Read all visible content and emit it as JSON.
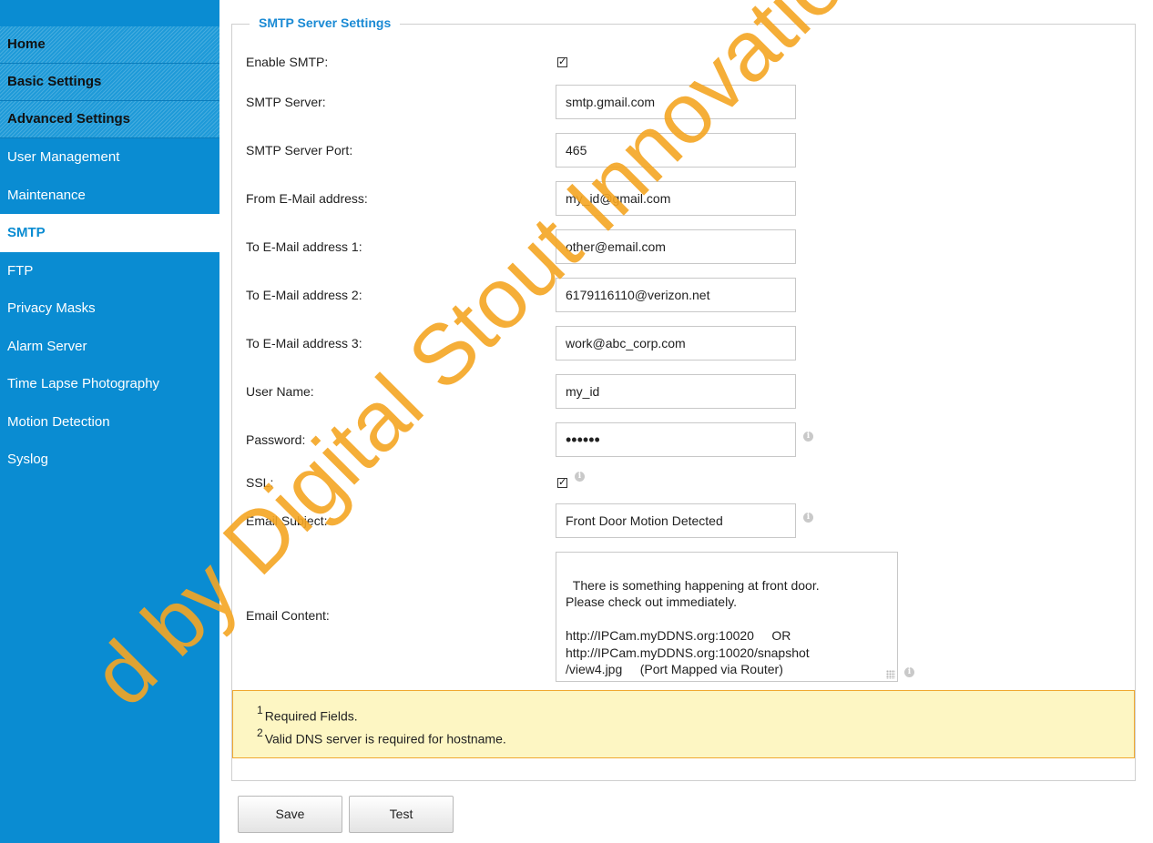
{
  "sidebar": {
    "sections": [
      "Home",
      "Basic Settings",
      "Advanced Settings"
    ],
    "items": [
      {
        "label": "User Management",
        "active": false
      },
      {
        "label": "Maintenance",
        "active": false
      },
      {
        "label": "SMTP",
        "active": true
      },
      {
        "label": "FTP",
        "active": false
      },
      {
        "label": "Privacy Masks",
        "active": false
      },
      {
        "label": "Alarm Server",
        "active": false
      },
      {
        "label": "Time Lapse Photography",
        "active": false
      },
      {
        "label": "Motion Detection",
        "active": false
      },
      {
        "label": "Syslog",
        "active": false
      }
    ]
  },
  "form": {
    "legend": "SMTP Server Settings",
    "enable_smtp": {
      "label": "Enable SMTP:",
      "checked": true
    },
    "smtp_server": {
      "label": "SMTP Server:",
      "value": "smtp.gmail.com"
    },
    "smtp_port": {
      "label": "SMTP Server Port:",
      "value": "465"
    },
    "from_email": {
      "label": "From E-Mail address:",
      "value": "my_id@gmail.com"
    },
    "to_email_1": {
      "label": "To E-Mail address 1:",
      "value": "other@email.com"
    },
    "to_email_2": {
      "label": "To E-Mail address 2:",
      "value": "6179116110@verizon.net"
    },
    "to_email_3": {
      "label": "To E-Mail address 3:",
      "value": "work@abc_corp.com"
    },
    "user_name": {
      "label": "User Name:",
      "value": "my_id"
    },
    "password": {
      "label": "Password:",
      "value": "••••••"
    },
    "ssl": {
      "label": "SSL:",
      "checked": true
    },
    "email_subject": {
      "label": "Email Subject:",
      "value": "Front Door Motion Detected"
    },
    "email_content": {
      "label": "Email Content:",
      "value": "There is something happening at front door.\nPlease check out immediately.\n\nhttp://IPCam.myDDNS.org:10020     OR\nhttp://IPCam.myDDNS.org:10020/snapshot\n/view4.jpg     (Port Mapped via Router)"
    }
  },
  "notes": {
    "note1_num": "1",
    "note1_text": "Required Fields.",
    "note2_num": "2",
    "note2_text": "Valid DNS server is required for hostname."
  },
  "buttons": {
    "save": "Save",
    "test": "Test"
  },
  "watermark": "d by Digital Stout Innovation & T",
  "colors": {
    "sidebar": "#0a8cd2",
    "legend": "#1a8ad4",
    "watermark": "#f5a623",
    "notes_bg": "#fdf6c3",
    "notes_border": "#f0a830"
  },
  "icons": {
    "checkbox": "check-mark",
    "info": "info-icon"
  }
}
